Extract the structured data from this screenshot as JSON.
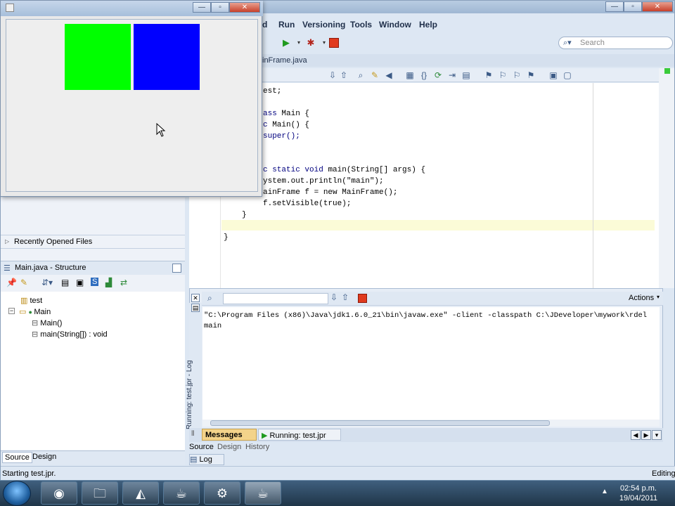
{
  "ide": {
    "menus": [
      "d",
      "Run",
      "Versioning",
      "Tools",
      "Window",
      "Help"
    ],
    "search_placeholder": "Search",
    "editor_tab": "inFrame.java",
    "code_lines": [
      {
        "pre": "",
        "kw": "",
        "rest": "est;"
      },
      {
        "pre": "",
        "kw": "ass ",
        "rest": "Main {"
      },
      {
        "pre": "",
        "kw": "",
        "rest": " Main() {"
      },
      {
        "pre": "",
        "kw": "",
        "rest": "uper();"
      },
      {
        "pre": "",
        "kw": " static void ",
        "rest": "main(String[] args) {"
      },
      {
        "pre": "",
        "kw": "",
        "rest": "ystem.out.println(\"main\");"
      },
      {
        "pre": "",
        "kw": "",
        "rest": "ainFrame f = new MainFrame();"
      },
      {
        "pre": "",
        "kw": "",
        "rest": "f.setVisible(true);"
      },
      {
        "pre": "",
        "kw": "",
        "rest": "}"
      },
      {
        "pre": "",
        "kw": "",
        "rest": ""
      },
      {
        "pre": "",
        "kw": "",
        "rest": "}"
      }
    ],
    "log": {
      "actions_label": "Actions",
      "output_lines": [
        "\"C:\\Program Files (x86)\\Java\\jdk1.6.0_21\\bin\\javaw.exe\" -client -classpath C:\\JDeveloper\\mywork\\rdel",
        "main"
      ],
      "side_label": "Running: test.jpr - Log",
      "tabs": [
        "Messages",
        "Running: test.jpr"
      ]
    },
    "editor_bottom_tabs": [
      "Source",
      "Design",
      "History"
    ],
    "log_button": "Log",
    "left": {
      "recent_files": "Recently Opened Files",
      "structure_title": "Main.java - Structure",
      "tree": [
        "test",
        "Main",
        "Main()",
        "main(String[]) : void"
      ],
      "bottom_tabs": [
        "Source",
        "Design"
      ]
    },
    "status": {
      "left": "Starting test.jpr.",
      "right": "Editing"
    }
  },
  "taskbar": {
    "time": "02:54 p.m.",
    "date": "19/04/2011"
  }
}
